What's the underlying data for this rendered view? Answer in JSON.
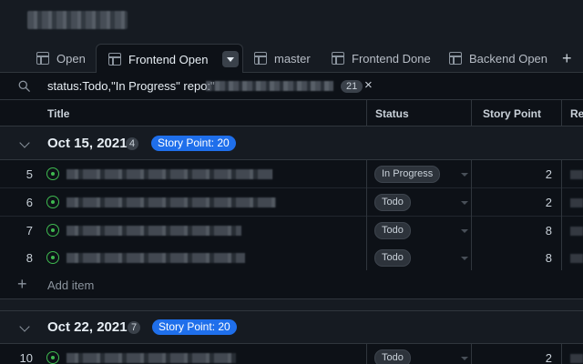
{
  "tabs": [
    {
      "label": "Open",
      "active": false
    },
    {
      "label": "Frontend Open",
      "active": true
    },
    {
      "label": "master",
      "active": false
    },
    {
      "label": "Frontend Done",
      "active": false
    },
    {
      "label": "Backend Open",
      "active": false
    }
  ],
  "add_tab_label": "+",
  "filter": {
    "query": "status:Todo,\"In Progress\" repo:\"",
    "count": "21",
    "clear_label": "×"
  },
  "columns": {
    "title": "Title",
    "status": "Status",
    "story_point": "Story Point",
    "repo": "Re"
  },
  "groups": [
    {
      "title": "Oct 15, 2021",
      "count": "4",
      "story_point_label": "Story Point: 20",
      "rows": [
        {
          "num": "5",
          "status": "In Progress",
          "points": "2"
        },
        {
          "num": "6",
          "status": "Todo",
          "points": "2"
        },
        {
          "num": "7",
          "status": "Todo",
          "points": "8"
        },
        {
          "num": "8",
          "status": "Todo",
          "points": "8"
        }
      ],
      "add_item_label": "Add item"
    },
    {
      "title": "Oct 22, 2021",
      "count": "7",
      "story_point_label": "Story Point: 20",
      "rows": [
        {
          "num": "10",
          "status": "Todo",
          "points": "2"
        }
      ]
    }
  ],
  "colors": {
    "background": "#0d1117",
    "accent_badge": "#1f6feb",
    "open_issue_icon": "#3fb950"
  }
}
